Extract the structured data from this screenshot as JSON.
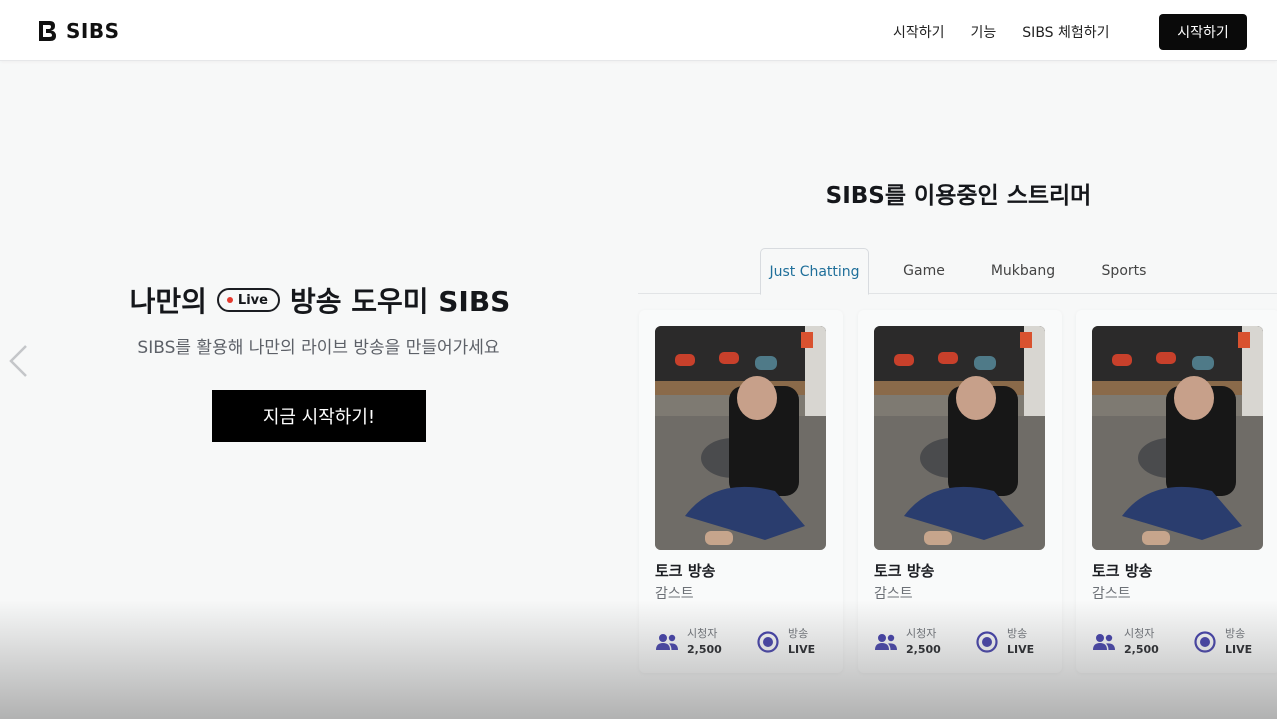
{
  "nav": {
    "logo_text": "SIBS",
    "links": [
      "시작하기",
      "기능",
      "SIBS 체험하기"
    ],
    "cta_label": "시작하기"
  },
  "hero": {
    "title_left": "나만의",
    "live_label": "Live",
    "title_right": "방송 도우미 SIBS",
    "subtitle": "SIBS를 활용해 나만의 라이브 방송을 만들어가세요",
    "cta_label": "지금 시작하기!"
  },
  "streamers": {
    "title": "SIBS를 이용중인 스트리머",
    "tabs": [
      "Just Chatting",
      "Game",
      "Mukbang",
      "Sports"
    ],
    "active_tab": "Just Chatting",
    "cards": [
      {
        "title": "토크 방송",
        "streamer": "감스트",
        "viewers_label": "시청자",
        "viewers_value": "2,500",
        "status_label": "방송",
        "status_value": "LIVE"
      },
      {
        "title": "토크 방송",
        "streamer": "감스트",
        "viewers_label": "시청자",
        "viewers_value": "2,500",
        "status_label": "방송",
        "status_value": "LIVE"
      },
      {
        "title": "토크 방송",
        "streamer": "감스트",
        "viewers_label": "시청자",
        "viewers_value": "2,500",
        "status_label": "방송",
        "status_value": "LIVE"
      }
    ]
  },
  "colors": {
    "accent_tab": "#1f6f9a",
    "icon_purple": "#3d3aa8",
    "live_dot": "#e43a2f"
  },
  "icons": {
    "prev": "chevron-left-icon",
    "viewers": "users-icon",
    "live": "radio-button-icon"
  }
}
